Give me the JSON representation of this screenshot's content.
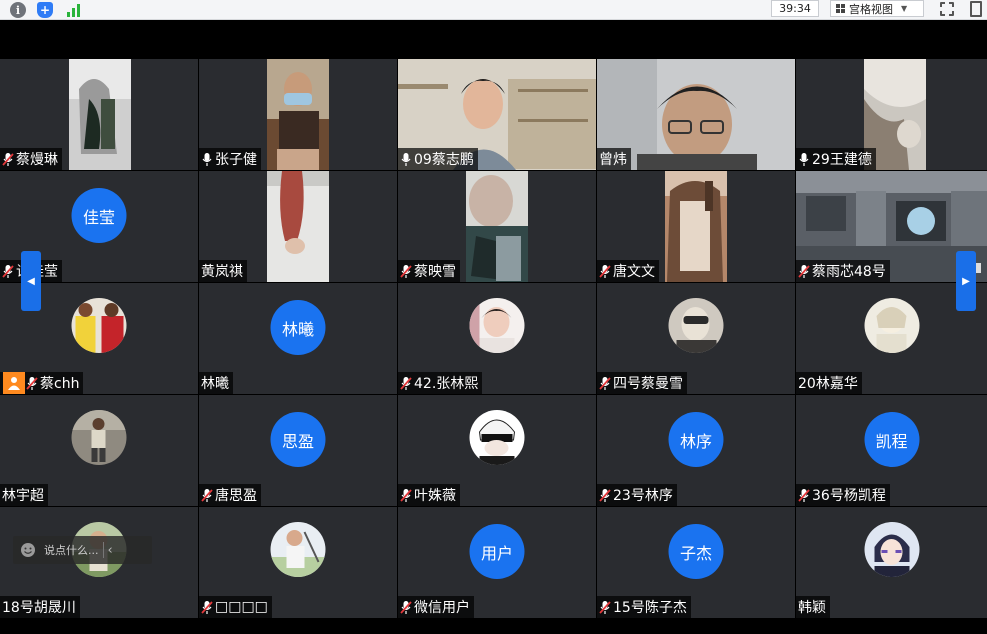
{
  "toolbar": {
    "info_icon": "info-icon",
    "shield_icon": "shield-icon",
    "signal_icon": "signal-icon",
    "timer": "39:34",
    "view_mode": "宫格视图",
    "fullscreen_icon": "fullscreen-icon",
    "window_icon": "window-icon"
  },
  "participants": [
    {
      "name": "蔡熳琳",
      "mic": "muted",
      "display": "video"
    },
    {
      "name": "张子健",
      "mic": "on",
      "display": "video"
    },
    {
      "name": "09蔡志鹏",
      "mic": "on",
      "display": "video"
    },
    {
      "name": "曾炜",
      "mic": "none",
      "display": "video"
    },
    {
      "name": "29王建德",
      "mic": "on",
      "display": "video"
    },
    {
      "name": "许佳莹",
      "mic": "muted",
      "display": "initials",
      "initials": "佳莹"
    },
    {
      "name": "黄岚祺",
      "mic": "none",
      "display": "video"
    },
    {
      "name": "蔡映雪",
      "mic": "muted",
      "display": "video"
    },
    {
      "name": "唐文文",
      "mic": "muted",
      "display": "video"
    },
    {
      "name": "蔡雨芯48号",
      "mic": "muted",
      "display": "video"
    },
    {
      "name": "蔡chh",
      "mic": "muted",
      "display": "photo"
    },
    {
      "name": "林曦",
      "mic": "none",
      "display": "initials",
      "initials": "林曦"
    },
    {
      "name": "42.张林熙",
      "mic": "muted",
      "display": "photo"
    },
    {
      "name": "四号蔡曼雪",
      "mic": "muted",
      "display": "photo"
    },
    {
      "name": "20林嘉华",
      "mic": "none",
      "display": "photo"
    },
    {
      "name": "林宇超",
      "mic": "none",
      "display": "photo"
    },
    {
      "name": "唐思盈",
      "mic": "muted",
      "display": "initials",
      "initials": "思盈"
    },
    {
      "name": "叶姝薇",
      "mic": "muted",
      "display": "photo"
    },
    {
      "name": "23号林序",
      "mic": "muted",
      "display": "initials",
      "initials": "林序"
    },
    {
      "name": "36号杨凯程",
      "mic": "muted",
      "display": "initials",
      "initials": "凯程"
    },
    {
      "name": "18号胡晟川",
      "mic": "none",
      "display": "photo"
    },
    {
      "name": "□□□□",
      "mic": "muted",
      "display": "photo"
    },
    {
      "name": "微信用户",
      "mic": "muted",
      "display": "initials",
      "initials": "用户"
    },
    {
      "name": "15号陈子杰",
      "mic": "muted",
      "display": "initials",
      "initials": "子杰"
    },
    {
      "name": "韩颖",
      "mic": "none",
      "display": "photo"
    }
  ],
  "chat": {
    "placeholder": "说点什么...",
    "emoji_icon": "emoji-icon",
    "collapse_icon": "chevron-left-icon"
  },
  "colors": {
    "avatar_blue": "#1a73f0",
    "tile_bg": "#2a2c30",
    "mute_red": "#e4393c",
    "nav_blue": "#1a6fe8",
    "badge_orange": "#ff8a1f"
  }
}
